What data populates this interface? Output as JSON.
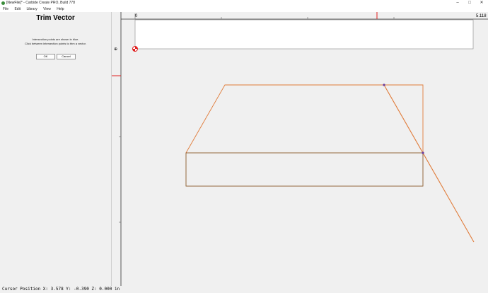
{
  "window": {
    "title": "[NewFile]* - Carbide Create PRO, Build 778",
    "minimize_glyph": "–",
    "maximize_glyph": "□",
    "close_glyph": "✕"
  },
  "menu": {
    "items": [
      "File",
      "Edit",
      "Library",
      "View",
      "Help"
    ]
  },
  "panel": {
    "title": "Trim Vector",
    "line1": "Intersection points are shown in blue.",
    "line2": "Click between intersection points to trim a vector.",
    "ok_label": "OK",
    "cancel_label": "Cancel"
  },
  "ruler": {
    "start_label": "0",
    "end_label": "5.118"
  },
  "status": {
    "cursor_text": "Cursor Position X: 3.578 Y: -0.390 Z: 0.000 in"
  },
  "colors": {
    "accent": "#e07b39",
    "intersection": "#6a3fa0",
    "marker": "#e02020"
  }
}
